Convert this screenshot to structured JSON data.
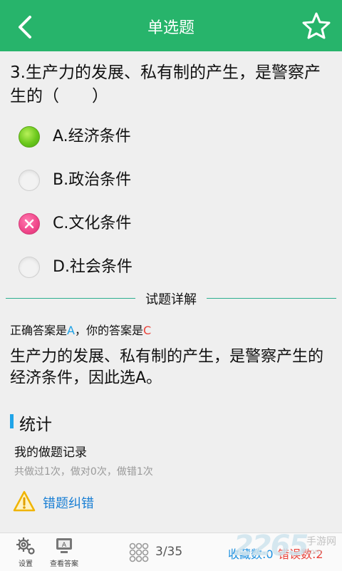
{
  "header": {
    "title": "单选题",
    "icons": {
      "back": "chevron-left-icon",
      "favorite": "star-outline-icon"
    },
    "bg_color": "#27b46b"
  },
  "question": {
    "text": "3.生产力的发展、私有制的产生，是警察产生的（　　）",
    "options": [
      {
        "label": "A.经济条件",
        "state": "correct"
      },
      {
        "label": "B.政治条件",
        "state": "unselected"
      },
      {
        "label": "C.文化条件",
        "state": "wrong"
      },
      {
        "label": "D.社会条件",
        "state": "unselected"
      }
    ]
  },
  "explanation": {
    "section_title": "试题详解",
    "answer_prefix": "正确答案是",
    "correct_answer": "A",
    "answer_mid": "，你的答案是",
    "user_answer": "C",
    "text": "生产力的发展、私有制的产生，是警察产生的经济条件，因此选A。"
  },
  "stats": {
    "title": "统计",
    "record_title": "我的做题记录",
    "record_detail": "共做过1次，做对0次，做错1次",
    "report_label": "错题纠错"
  },
  "bottom_bar": {
    "settings_label": "设置",
    "view_answer_label": "查看答案",
    "progress": "3/35",
    "favorites_count": "收藏数:0",
    "errors_count": "错误数:2"
  },
  "watermark": {
    "logo": "2265",
    "name": "手游网",
    "url": "com"
  },
  "colors": {
    "correct": "#6bc81c",
    "wrong": "#f0468a",
    "accent_blue": "#1aa0e6",
    "accent_red": "#e9433b"
  }
}
